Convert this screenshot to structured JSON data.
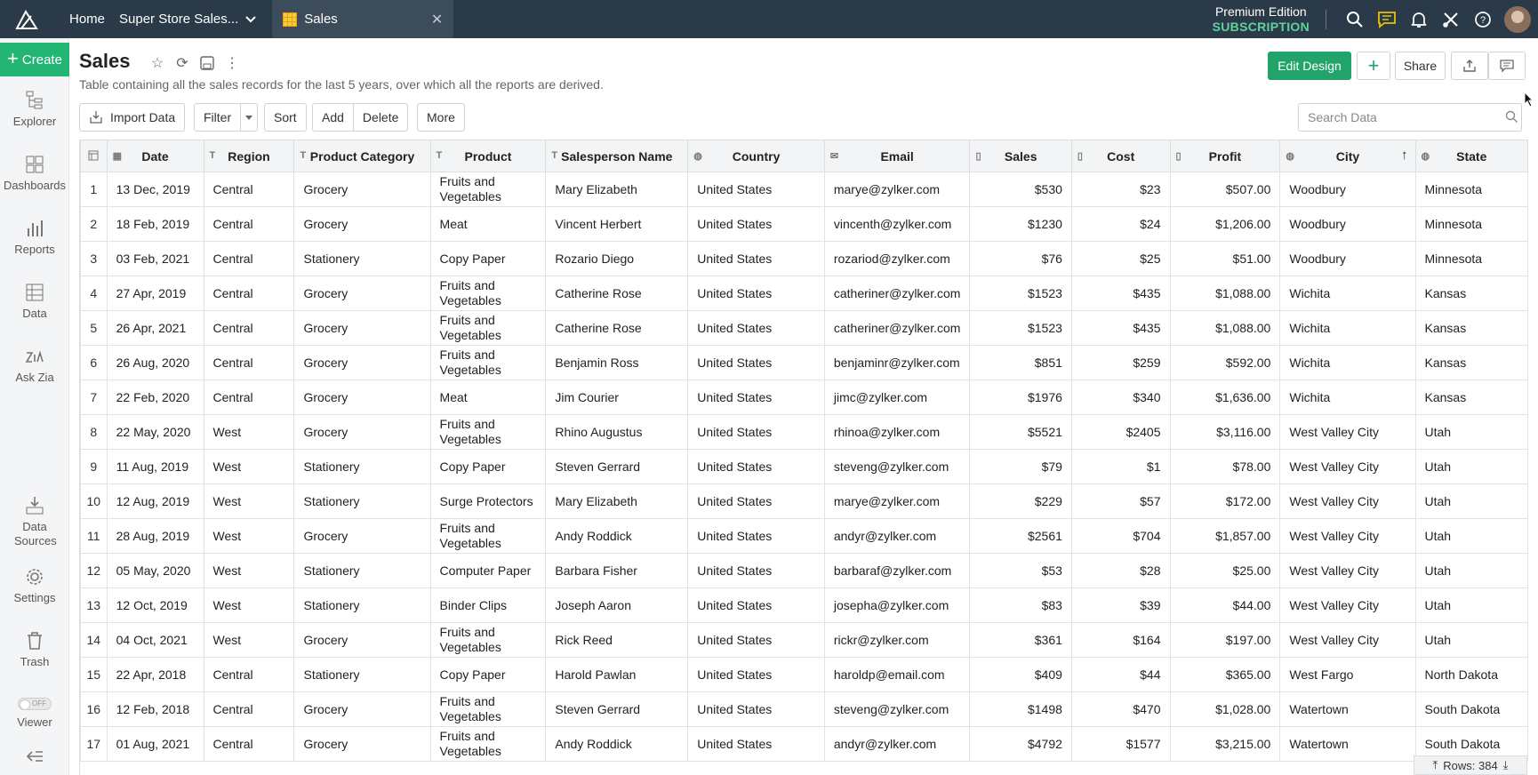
{
  "topbar": {
    "home": "Home",
    "workspace": "Super Store Sales...",
    "tab": "Sales",
    "edition_line1": "Premium Edition",
    "edition_line2": "SUBSCRIPTION"
  },
  "sidebar": {
    "create": "Create",
    "items": [
      "Explorer",
      "Dashboards",
      "Reports",
      "Data",
      "Ask Zia",
      "Data Sources",
      "Settings",
      "Trash",
      "Viewer"
    ],
    "toggle": "OFF"
  },
  "header": {
    "title": "Sales",
    "subtitle": "Table containing all the sales records for the last 5 years, over which all the reports are derived.",
    "edit_design": "Edit Design",
    "share": "Share"
  },
  "toolbar": {
    "import": "Import Data",
    "filter": "Filter",
    "sort": "Sort",
    "add": "Add",
    "delete": "Delete",
    "more": "More",
    "search_placeholder": "Search Data"
  },
  "table": {
    "columns": [
      "Date",
      "Region",
      "Product Category",
      "Product",
      "Salesperson Name",
      "Country",
      "Email",
      "Sales",
      "Cost",
      "Profit",
      "City",
      "State"
    ],
    "rows": [
      [
        "1",
        "13 Dec, 2019",
        "Central",
        "Grocery",
        "Fruits and Vegetables",
        "Mary Elizabeth",
        "United States",
        "marye@zylker.com",
        "$530",
        "$23",
        "$507.00",
        "Woodbury",
        "Minnesota"
      ],
      [
        "2",
        "18 Feb, 2019",
        "Central",
        "Grocery",
        "Meat",
        "Vincent Herbert",
        "United States",
        "vincenth@zylker.com",
        "$1230",
        "$24",
        "$1,206.00",
        "Woodbury",
        "Minnesota"
      ],
      [
        "3",
        "03 Feb, 2021",
        "Central",
        "Stationery",
        "Copy Paper",
        "Rozario Diego",
        "United States",
        "rozariod@zylker.com",
        "$76",
        "$25",
        "$51.00",
        "Woodbury",
        "Minnesota"
      ],
      [
        "4",
        "27 Apr, 2019",
        "Central",
        "Grocery",
        "Fruits and Vegetables",
        "Catherine Rose",
        "United States",
        "catheriner@zylker.com",
        "$1523",
        "$435",
        "$1,088.00",
        "Wichita",
        "Kansas"
      ],
      [
        "5",
        "26 Apr, 2021",
        "Central",
        "Grocery",
        "Fruits and Vegetables",
        "Catherine Rose",
        "United States",
        "catheriner@zylker.com",
        "$1523",
        "$435",
        "$1,088.00",
        "Wichita",
        "Kansas"
      ],
      [
        "6",
        "26 Aug, 2020",
        "Central",
        "Grocery",
        "Fruits and Vegetables",
        "Benjamin Ross",
        "United States",
        "benjaminr@zylker.com",
        "$851",
        "$259",
        "$592.00",
        "Wichita",
        "Kansas"
      ],
      [
        "7",
        "22 Feb, 2020",
        "Central",
        "Grocery",
        "Meat",
        "Jim Courier",
        "United States",
        "jimc@zylker.com",
        "$1976",
        "$340",
        "$1,636.00",
        "Wichita",
        "Kansas"
      ],
      [
        "8",
        "22 May, 2020",
        "West",
        "Grocery",
        "Fruits and Vegetables",
        "Rhino Augustus",
        "United States",
        "rhinoa@zylker.com",
        "$5521",
        "$2405",
        "$3,116.00",
        "West Valley City",
        "Utah"
      ],
      [
        "9",
        "11 Aug, 2019",
        "West",
        "Stationery",
        "Copy Paper",
        "Steven Gerrard",
        "United States",
        "steveng@zylker.com",
        "$79",
        "$1",
        "$78.00",
        "West Valley City",
        "Utah"
      ],
      [
        "10",
        "12 Aug, 2019",
        "West",
        "Stationery",
        "Surge Protectors",
        "Mary Elizabeth",
        "United States",
        "marye@zylker.com",
        "$229",
        "$57",
        "$172.00",
        "West Valley City",
        "Utah"
      ],
      [
        "11",
        "28 Aug, 2019",
        "West",
        "Grocery",
        "Fruits and Vegetables",
        "Andy Roddick",
        "United States",
        "andyr@zylker.com",
        "$2561",
        "$704",
        "$1,857.00",
        "West Valley City",
        "Utah"
      ],
      [
        "12",
        "05 May, 2020",
        "West",
        "Stationery",
        "Computer Paper",
        "Barbara Fisher",
        "United States",
        "barbaraf@zylker.com",
        "$53",
        "$28",
        "$25.00",
        "West Valley City",
        "Utah"
      ],
      [
        "13",
        "12 Oct, 2019",
        "West",
        "Stationery",
        "Binder Clips",
        "Joseph Aaron",
        "United States",
        "josepha@zylker.com",
        "$83",
        "$39",
        "$44.00",
        "West Valley City",
        "Utah"
      ],
      [
        "14",
        "04 Oct, 2021",
        "West",
        "Grocery",
        "Fruits and Vegetables",
        "Rick Reed",
        "United States",
        "rickr@zylker.com",
        "$361",
        "$164",
        "$197.00",
        "West Valley City",
        "Utah"
      ],
      [
        "15",
        "22 Apr, 2018",
        "Central",
        "Stationery",
        "Copy Paper",
        "Harold Pawlan",
        "United States",
        "haroldp@email.com",
        "$409",
        "$44",
        "$365.00",
        "West Fargo",
        "North Dakota"
      ],
      [
        "16",
        "12 Feb, 2018",
        "Central",
        "Grocery",
        "Fruits and Vegetables",
        "Steven Gerrard",
        "United States",
        "steveng@zylker.com",
        "$1498",
        "$470",
        "$1,028.00",
        "Watertown",
        "South Dakota"
      ],
      [
        "17",
        "01 Aug, 2021",
        "Central",
        "Grocery",
        "Fruits and Vegetables",
        "Andy Roddick",
        "United States",
        "andyr@zylker.com",
        "$4792",
        "$1577",
        "$3,215.00",
        "Watertown",
        "South Dakota"
      ]
    ],
    "rows_count": "Rows: 384"
  }
}
